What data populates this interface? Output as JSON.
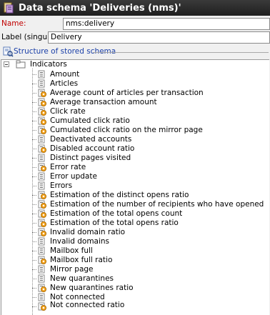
{
  "window": {
    "title": "Data schema 'Deliveries (nms)'"
  },
  "fields": {
    "name_label": "Name:",
    "name_value": "nms:delivery",
    "label_singular_label": "Label (singular):",
    "label_singular_value": "Delivery"
  },
  "section": {
    "title": "Structure of stored schema"
  },
  "tree": {
    "root": {
      "label": "Indicators",
      "icon": "folder-icon",
      "expanded": true
    },
    "items": [
      {
        "label": "Amount",
        "icon": "field-icon"
      },
      {
        "label": "Articles",
        "icon": "field-icon"
      },
      {
        "label": "Average count of articles per transaction",
        "icon": "computed-field-icon"
      },
      {
        "label": "Average transaction amount",
        "icon": "computed-field-icon"
      },
      {
        "label": "Click rate",
        "icon": "computed-field-icon"
      },
      {
        "label": "Cumulated click ratio",
        "icon": "computed-field-icon"
      },
      {
        "label": "Cumulated click ratio on the mirror page",
        "icon": "computed-field-icon"
      },
      {
        "label": "Deactivated accounts",
        "icon": "field-icon"
      },
      {
        "label": "Disabled account ratio",
        "icon": "computed-field-icon"
      },
      {
        "label": "Distinct pages visited",
        "icon": "field-icon"
      },
      {
        "label": "Error rate",
        "icon": "computed-field-icon"
      },
      {
        "label": "Error update",
        "icon": "field-icon"
      },
      {
        "label": "Errors",
        "icon": "field-icon"
      },
      {
        "label": "Estimation of the distinct opens ratio",
        "icon": "computed-field-icon"
      },
      {
        "label": "Estimation of the number of recipients who have opened",
        "icon": "computed-field-icon"
      },
      {
        "label": "Estimation of the total opens count",
        "icon": "computed-field-icon"
      },
      {
        "label": "Estimation of the total opens ratio",
        "icon": "computed-field-icon"
      },
      {
        "label": "Invalid domain ratio",
        "icon": "computed-field-icon"
      },
      {
        "label": "Invalid domains",
        "icon": "field-icon"
      },
      {
        "label": "Mailbox full",
        "icon": "field-icon"
      },
      {
        "label": "Mailbox full ratio",
        "icon": "computed-field-icon"
      },
      {
        "label": "Mirror page",
        "icon": "field-icon"
      },
      {
        "label": "New quarantines",
        "icon": "field-icon"
      },
      {
        "label": "New quarantines ratio",
        "icon": "computed-field-icon"
      },
      {
        "label": "Not connected",
        "icon": "field-icon"
      },
      {
        "label": "Not connected ratio",
        "icon": "computed-field-icon"
      }
    ]
  },
  "colors": {
    "title_bar": "#2b2b2b",
    "name_label": "#c00000",
    "link_blue": "#1a3fa8",
    "computed_icon": "#f5a623"
  }
}
